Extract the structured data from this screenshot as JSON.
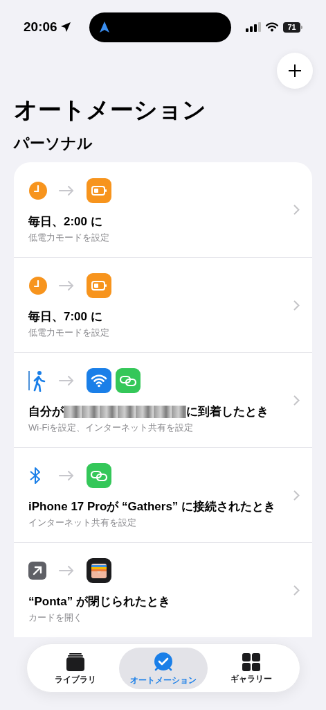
{
  "status_bar": {
    "time": "20:06",
    "battery": "71"
  },
  "title": "オートメーション",
  "section": "パーソナル",
  "automations": [
    {
      "trigger": {
        "kind": "clock"
      },
      "actions": [
        {
          "kind": "battery"
        }
      ],
      "title": [
        {
          "kind": "text",
          "text": "毎日、2:00 に"
        }
      ],
      "subtitle": "低電力モードを設定"
    },
    {
      "trigger": {
        "kind": "clock"
      },
      "actions": [
        {
          "kind": "battery"
        }
      ],
      "title": [
        {
          "kind": "text",
          "text": "毎日、7:00 に"
        }
      ],
      "subtitle": "低電力モードを設定"
    },
    {
      "trigger": {
        "kind": "arrive"
      },
      "actions": [
        {
          "kind": "wifi"
        },
        {
          "kind": "link"
        }
      ],
      "title": [
        {
          "kind": "text",
          "text": "自分が"
        },
        {
          "kind": "redacted"
        },
        {
          "kind": "text",
          "text": "に到着したとき"
        }
      ],
      "subtitle": "Wi-Fiを設定、インターネット共有を設定"
    },
    {
      "trigger": {
        "kind": "bluetooth"
      },
      "actions": [
        {
          "kind": "link"
        }
      ],
      "title": [
        {
          "kind": "text",
          "text": "iPhone 17 Proが “Gathers” に接続されたとき"
        }
      ],
      "subtitle": "インターネット共有を設定"
    },
    {
      "trigger": {
        "kind": "app"
      },
      "actions": [
        {
          "kind": "wallet"
        }
      ],
      "title": [
        {
          "kind": "text",
          "text": "“Ponta” が閉じられたとき"
        }
      ],
      "subtitle": "カードを開く"
    }
  ],
  "tabs": [
    {
      "label": "ライブラリ",
      "selected": false
    },
    {
      "label": "オートメーション",
      "selected": true
    },
    {
      "label": "ギャラリー",
      "selected": false
    }
  ]
}
